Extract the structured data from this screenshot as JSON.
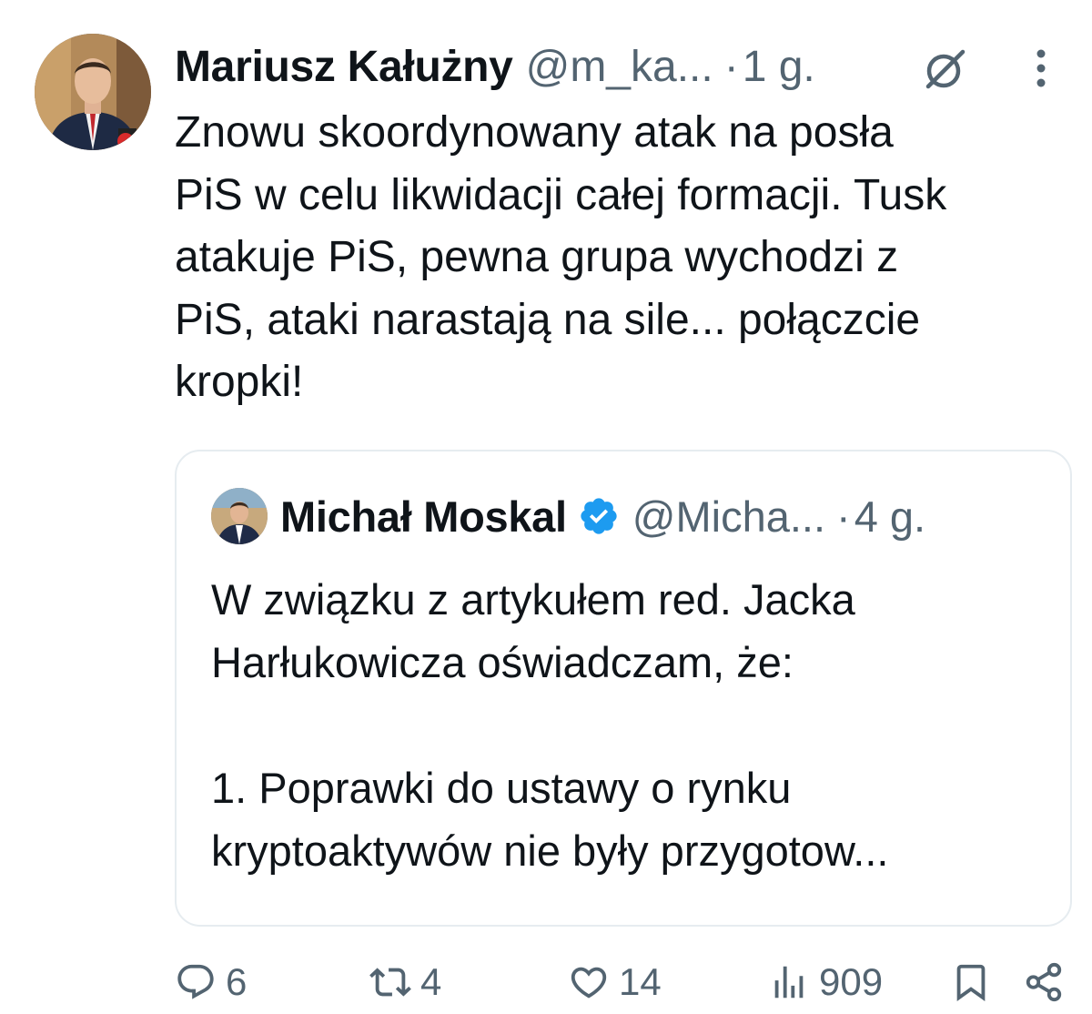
{
  "tweet": {
    "author_name": "Mariusz Kałużny",
    "handle": "@m_ka...",
    "dot": "·",
    "time": "1 g.",
    "text": "Znowu skoordynowany atak na posła\nPiS w celu likwidacji całej formacji. Tusk\natakuje PiS, pewna grupa wychodzi z\nPiS, ataki narastają na sile... połączcie\nkropki!",
    "icons": {
      "grok": "grok-icon",
      "more": "more-icon"
    }
  },
  "quote": {
    "author_name": "Michał Moskal",
    "verified": true,
    "handle": "@Micha...",
    "dot": "·",
    "time": "4 g.",
    "text": "W związku z artykułem red. Jacka\nHarłukowicza oświadczam, że:\n\n1. Poprawki do ustawy o rynku\nkryptoaktywów nie były przygotow..."
  },
  "actions": {
    "replies": "6",
    "reposts": "4",
    "likes": "14",
    "views": "909"
  },
  "colors": {
    "text": "#0f1419",
    "secondary": "#536471",
    "verified": "#1d9bf0",
    "border": "#e6ecf0"
  }
}
